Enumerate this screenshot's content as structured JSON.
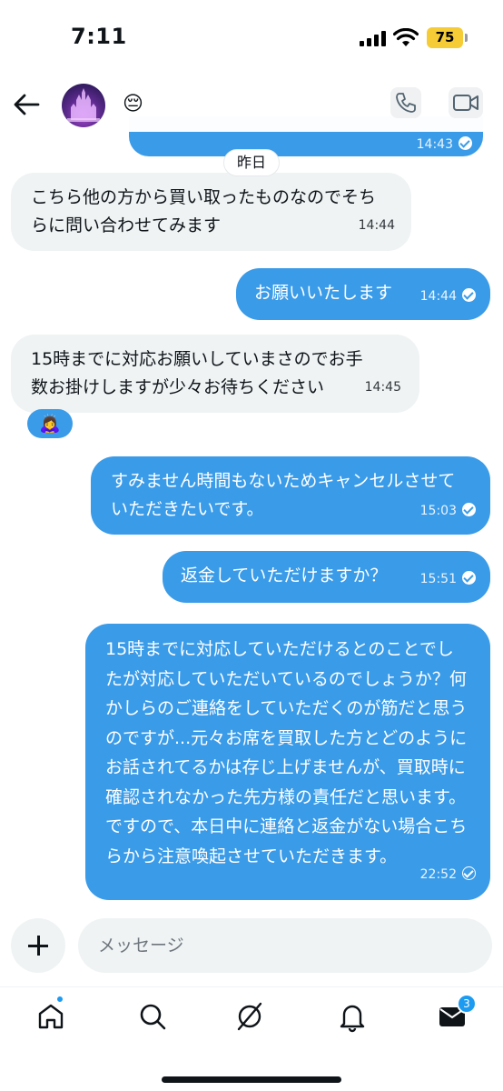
{
  "status_bar": {
    "time": "7:11",
    "battery": "75"
  },
  "header": {
    "emoji": "😔"
  },
  "date_divider": "昨日",
  "messages": [
    {
      "direction": "out",
      "text": "",
      "time": "14:43"
    },
    {
      "direction": "in",
      "text": "こちら他の方から買い取ったものなのでそちらに問い合わせてみます",
      "time": "14:44"
    },
    {
      "direction": "out",
      "text": "お願いいたします",
      "time": "14:44"
    },
    {
      "direction": "in",
      "text": "15時までに対応お願いしていまさのでお手数お掛けしますが少々お待ちください",
      "time": "14:45",
      "reaction": "🙇‍♀️"
    },
    {
      "direction": "out",
      "text": "すみません時間もないためキャンセルさせていただきたいです。",
      "time": "15:03"
    },
    {
      "direction": "out",
      "text": "返金していただけますか？",
      "time": "15:51"
    },
    {
      "direction": "out",
      "text": "15時までに対応していただけるとのことでしたが対応していただいているのでしょうか？何かしらのご連絡をしていただくのが筋だと思うのですが...元々お席を買取した方とどのようにお話されてるかは存じ上げませんが、買取時に確認されなかった先方様の責任だと思います。ですので、本日中に連絡と返金がない場合こちらから注意喚起させていただきます。",
      "time": "22:52"
    }
  ],
  "composer": {
    "placeholder": "メッセージ"
  },
  "nav": {
    "messages_badge": "3"
  },
  "colors": {
    "accent": "#1d9bf0",
    "outgoing_bubble": "#3a9be8",
    "incoming_bubble": "#eff3f4"
  }
}
